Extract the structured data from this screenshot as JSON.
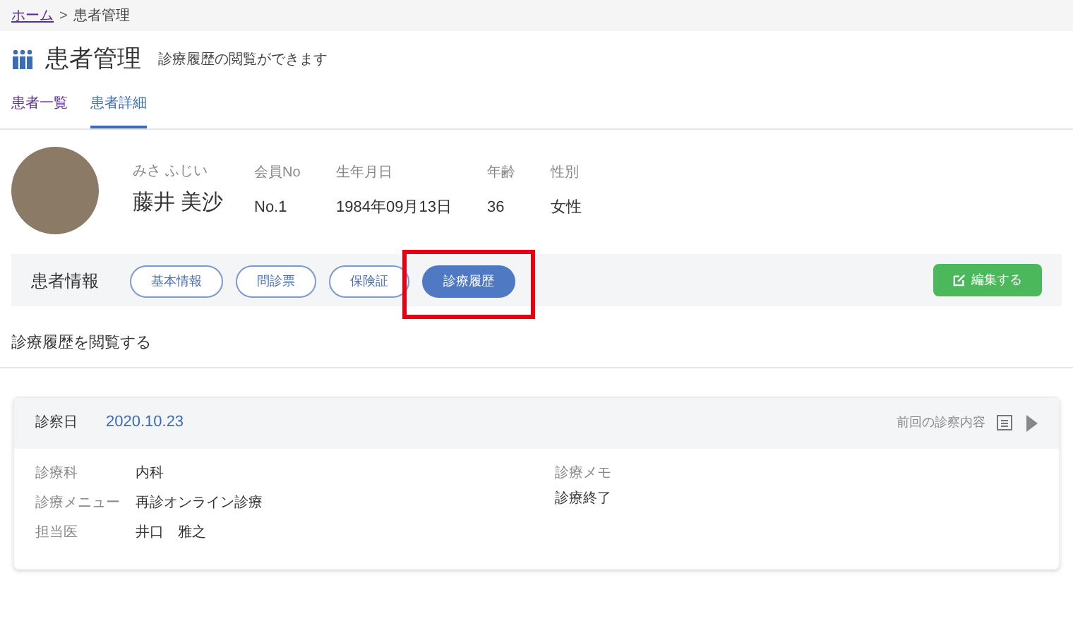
{
  "breadcrumb": [
    {
      "label": "ホーム",
      "link": true
    },
    {
      "label": "患者管理",
      "link": false
    }
  ],
  "breadcrumb_separator": ">",
  "page": {
    "title": "患者管理",
    "subtitle": "診療履歴の閲覧ができます"
  },
  "tabs": [
    {
      "label": "患者一覧",
      "selected": false
    },
    {
      "label": "患者詳細",
      "selected": true
    }
  ],
  "patient": {
    "kana": "みさ ふじい",
    "name": "藤井 美沙",
    "fields": [
      {
        "label": "会員No",
        "value": "No.1"
      },
      {
        "label": "生年月日",
        "value": "1984年09月13日"
      },
      {
        "label": "年齢",
        "value": "36"
      },
      {
        "label": "性別",
        "value": "女性"
      }
    ]
  },
  "info_bar": {
    "label": "患者情報",
    "buttons": [
      {
        "label": "基本情報",
        "selected": false,
        "highlighted": false
      },
      {
        "label": "問診票",
        "selected": false,
        "highlighted": false
      },
      {
        "label": "保険証",
        "selected": false,
        "highlighted": false
      },
      {
        "label": "診療履歴",
        "selected": true,
        "highlighted": true
      }
    ],
    "edit_button": "編集する"
  },
  "section_title": "診療履歴を閲覧する",
  "records": [
    {
      "date_label": "診察日",
      "date": "2020.10.23",
      "previous_link": "前回の診察内容",
      "details": [
        {
          "label": "診療科",
          "value": "内科"
        },
        {
          "label": "診療メニュー",
          "value": "再診オンライン診療"
        },
        {
          "label": "担当医",
          "value": "井口　雅之"
        }
      ],
      "memo_label": "診療メモ",
      "memo": "診療終了"
    }
  ]
}
